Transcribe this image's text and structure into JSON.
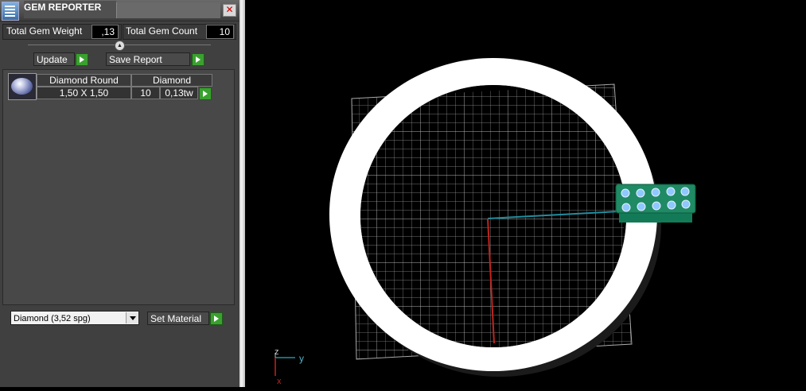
{
  "window": {
    "title": "GEM REPORTER",
    "close": "✕"
  },
  "stats": {
    "weight_label": "Total Gem Weight",
    "weight_value": ",13",
    "count_label": "Total Gem Count",
    "count_value": "10"
  },
  "actions": {
    "update_label": "Update",
    "save_label": "Save Report"
  },
  "gem_table": {
    "header_name": "Diamond Round",
    "header_material": "Diamond",
    "size": "1,50 X 1,50",
    "count": "10",
    "weight": "0,13tw"
  },
  "material": {
    "selected": "Diamond     (3,52 spg)",
    "set_label": "Set Material"
  },
  "axes": {
    "z": "z",
    "y": "y",
    "x": "x"
  },
  "colors": {
    "panel_bg": "#404040",
    "accent_green": "#3aa12f",
    "viewport_bg": "#000000",
    "ring": "#ffffff",
    "gem_setting": "#1f8a64",
    "axis_x": "#c0241e",
    "axis_y": "#1f8fa0"
  }
}
